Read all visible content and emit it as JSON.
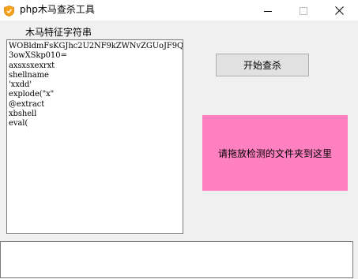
{
  "window": {
    "title": "php木马查杀工具",
    "app_icon": "shield-icon",
    "controls": {
      "minimize_icon": "minimize-icon",
      "maximize_icon": "maximize-icon",
      "close_icon": "close-icon"
    }
  },
  "signatures": {
    "label": "木马特征字符串",
    "items": [
      "WOBldmFsKGJhc2U2NF9kZWNvZGUoJF9QT1NUW",
      "3owXSkp010=",
      "axsxsxexrxt",
      "shellname",
      "'xxdd'",
      "explode(\"x\"",
      "@extract",
      "xbshell",
      "eval("
    ]
  },
  "actions": {
    "start_label": "开始查杀"
  },
  "drop_zone": {
    "label": "请拖放检测的文件夹到这里",
    "color": "#ff80c0"
  },
  "output": {
    "value": ""
  },
  "colors": {
    "window_bg": "#f0f0f0",
    "titlebar_bg": "#ffffff",
    "icon_orange": "#f7a21b"
  }
}
